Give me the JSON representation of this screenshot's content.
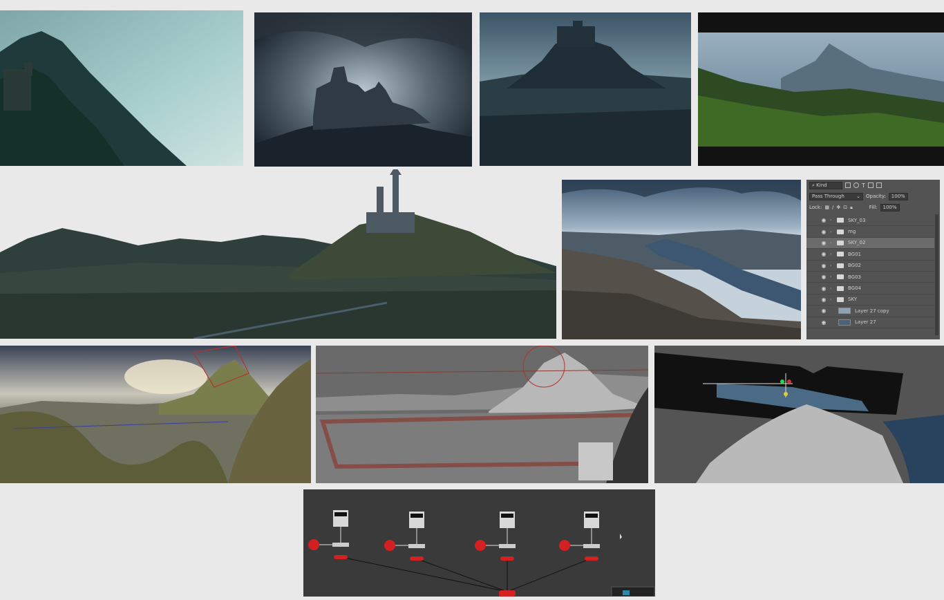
{
  "layers_panel": {
    "search_kind": "Kind",
    "blend_mode": "Pass Through",
    "opacity_label": "Opacity:",
    "opacity_value": "100%",
    "lock_label": "Lock:",
    "fill_label": "Fill:",
    "fill_value": "100%",
    "layers": [
      {
        "name": "SKY_03",
        "type": "group",
        "selected": false
      },
      {
        "name": "mg",
        "type": "group",
        "selected": false
      },
      {
        "name": "SKY_02",
        "type": "group",
        "selected": true
      },
      {
        "name": "BG01",
        "type": "group",
        "selected": false
      },
      {
        "name": "BG02",
        "type": "group",
        "selected": false
      },
      {
        "name": "BG03",
        "type": "group",
        "selected": false
      },
      {
        "name": "BG04",
        "type": "group",
        "selected": false
      },
      {
        "name": "SKY",
        "type": "group",
        "selected": false
      },
      {
        "name": "Layer 27 copy",
        "type": "layer",
        "selected": false
      },
      {
        "name": "Layer 27",
        "type": "layer",
        "selected": false
      }
    ]
  },
  "icons": [
    "search-icon",
    "eye-icon",
    "folder-icon",
    "lock-icon",
    "brush-icon",
    "move-icon",
    "chevron-down-icon"
  ],
  "colors": {
    "background": "#e9e9e9",
    "panel": "#535353",
    "node_red": "#d32020",
    "wireframe_red": "#b4322a"
  }
}
